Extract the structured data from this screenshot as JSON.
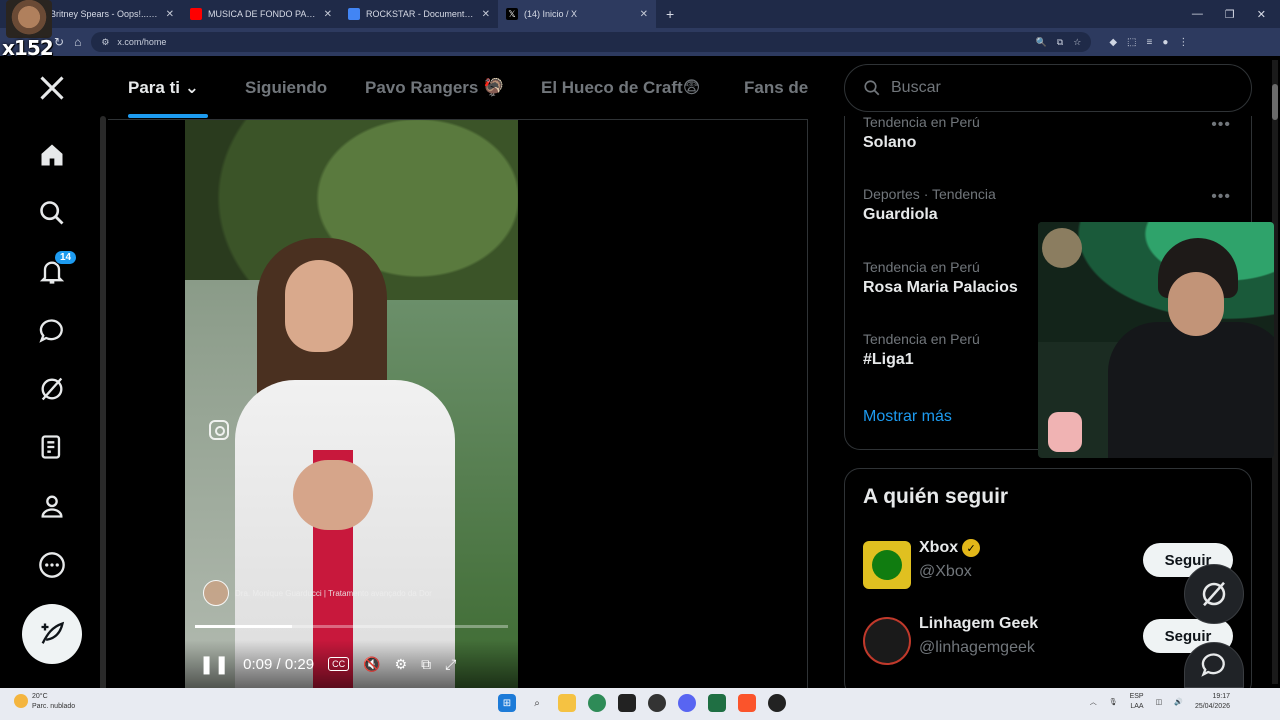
{
  "browser": {
    "tabs": [
      {
        "label": "Britney Spears - Oops!...I Did It",
        "favicon_color": "#e0332b"
      },
      {
        "label": "MUSICA DE FONDO PARA H",
        "favicon_color": "#ff0000"
      },
      {
        "label": "ROCKSTAR - Documentos de G",
        "favicon_color": "#4285f4"
      },
      {
        "label": "(14) Inicio / X",
        "favicon_color": "#000000"
      }
    ],
    "url": "x.com/home",
    "new_tab": "+"
  },
  "overlay": {
    "streamer_tag": "x152"
  },
  "nav": {
    "notifications_badge": "14"
  },
  "feed": {
    "tabs": [
      "Para ti",
      "Siguiendo",
      "Pavo Rangers 🦃",
      "El Hueco de Craft😨",
      "Fans de"
    ],
    "active_tab": "Para ti"
  },
  "video": {
    "credit_text": "Dra. Monique Guarducci | Tratamento avançado da Dor",
    "time": "0:09 / 0:29",
    "progress": 0.31,
    "cc_label": "CC"
  },
  "sidebar": {
    "search_placeholder": "Buscar",
    "trends": [
      {
        "context": "Tendencia en Perú",
        "name": "Solano"
      },
      {
        "context": "Deportes · Tendencia",
        "name": "Guardiola"
      },
      {
        "context": "Tendencia en Perú",
        "name": "Rosa Maria Palacios"
      },
      {
        "context": "Tendencia en Perú",
        "name": "#Liga1"
      }
    ],
    "show_more": "Mostrar más",
    "who_to_follow_title": "A quién seguir",
    "accounts": [
      {
        "name": "Xbox",
        "handle": "@Xbox",
        "verified": true,
        "follow_label": "Seguir"
      },
      {
        "name": "Linhagem Geek",
        "handle": "@linhagemgeek",
        "verified": false,
        "follow_label": "Seguir"
      }
    ]
  },
  "taskbar": {
    "weather_temp": "20°C",
    "weather_desc": "Parc. nublado",
    "lang": "ESP",
    "lang_sub": "LAA",
    "time": "19:17",
    "date": "25/04/2026"
  },
  "colors": {
    "accent": "#1d9bf0",
    "background": "#000000",
    "muted_text": "#71767b"
  }
}
